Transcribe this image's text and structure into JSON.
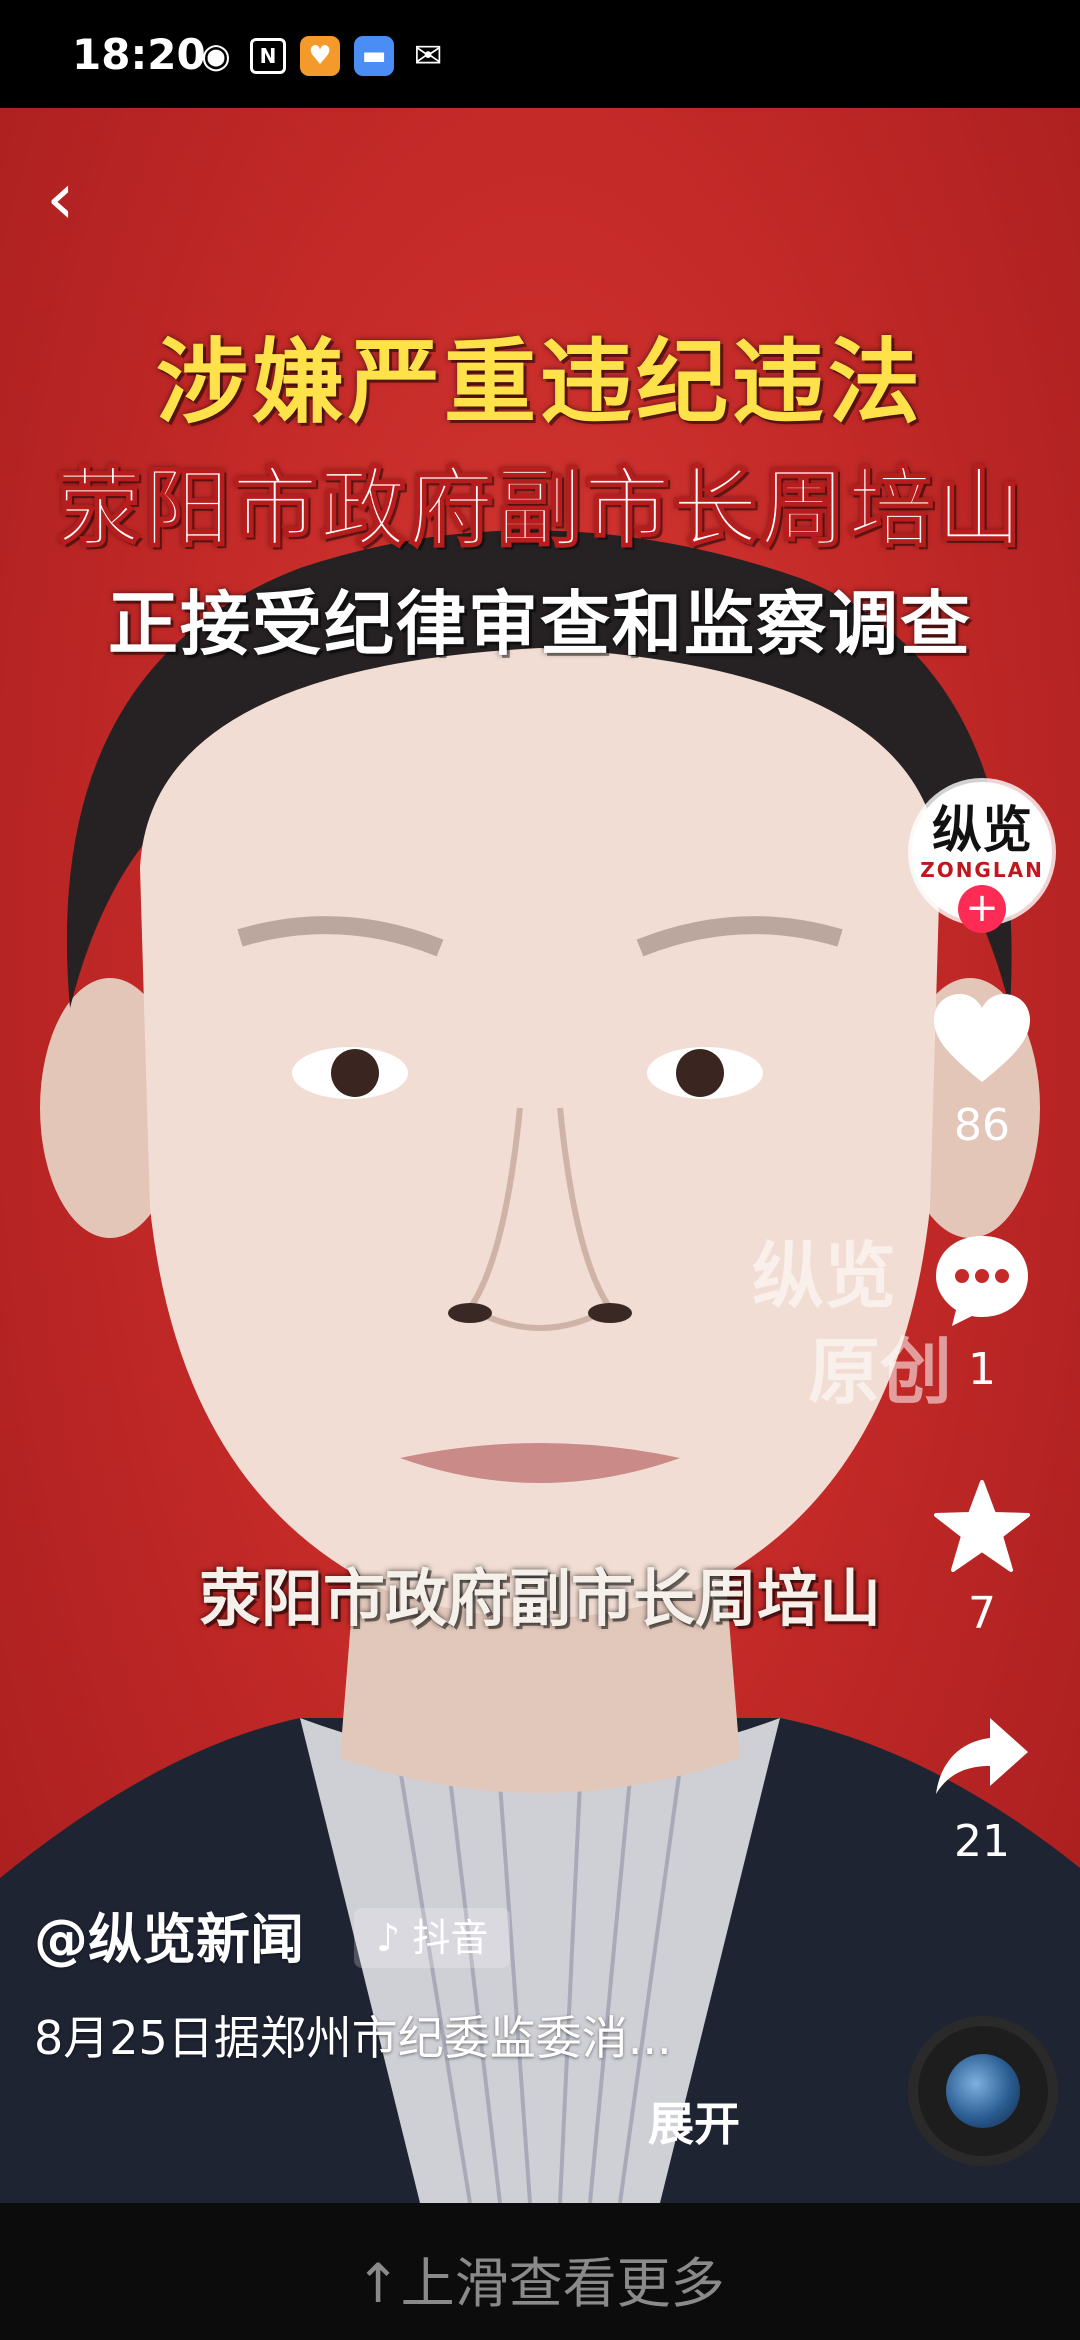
{
  "status_bar": {
    "time": "18:20",
    "icons": [
      "eye-icon",
      "nfc-icon",
      "orange-app-icon",
      "blue-app-icon",
      "wechat-icon"
    ]
  },
  "video": {
    "headline_line1": "涉嫌严重违纪违法",
    "headline_line2": "荥阳市政府副市长周培山",
    "headline_line3": "正接受纪律审查和监察调查",
    "subtitle": "荥阳市政府副市长周培山",
    "watermark_line1": "纵览",
    "watermark_line2": "原创"
  },
  "channel_avatar": {
    "logo_text_main": "纵览",
    "logo_text_sub": "ZONGLAN",
    "follow_symbol": "+"
  },
  "actions": {
    "like_count": "86",
    "comment_count": "1",
    "favorite_count": "7",
    "share_count": "21"
  },
  "caption": {
    "author": "@纵览新闻",
    "platform_tag": "♪ 抖音",
    "description": "8月25日据郑州市纪委监委消...",
    "expand_label": "展开"
  },
  "bottom_bar": {
    "hint": "↑上滑查看更多"
  },
  "colors": {
    "background_red": "#c42a28",
    "headline_yellow": "#ffe24a",
    "follow_pink": "#fe2c55"
  }
}
